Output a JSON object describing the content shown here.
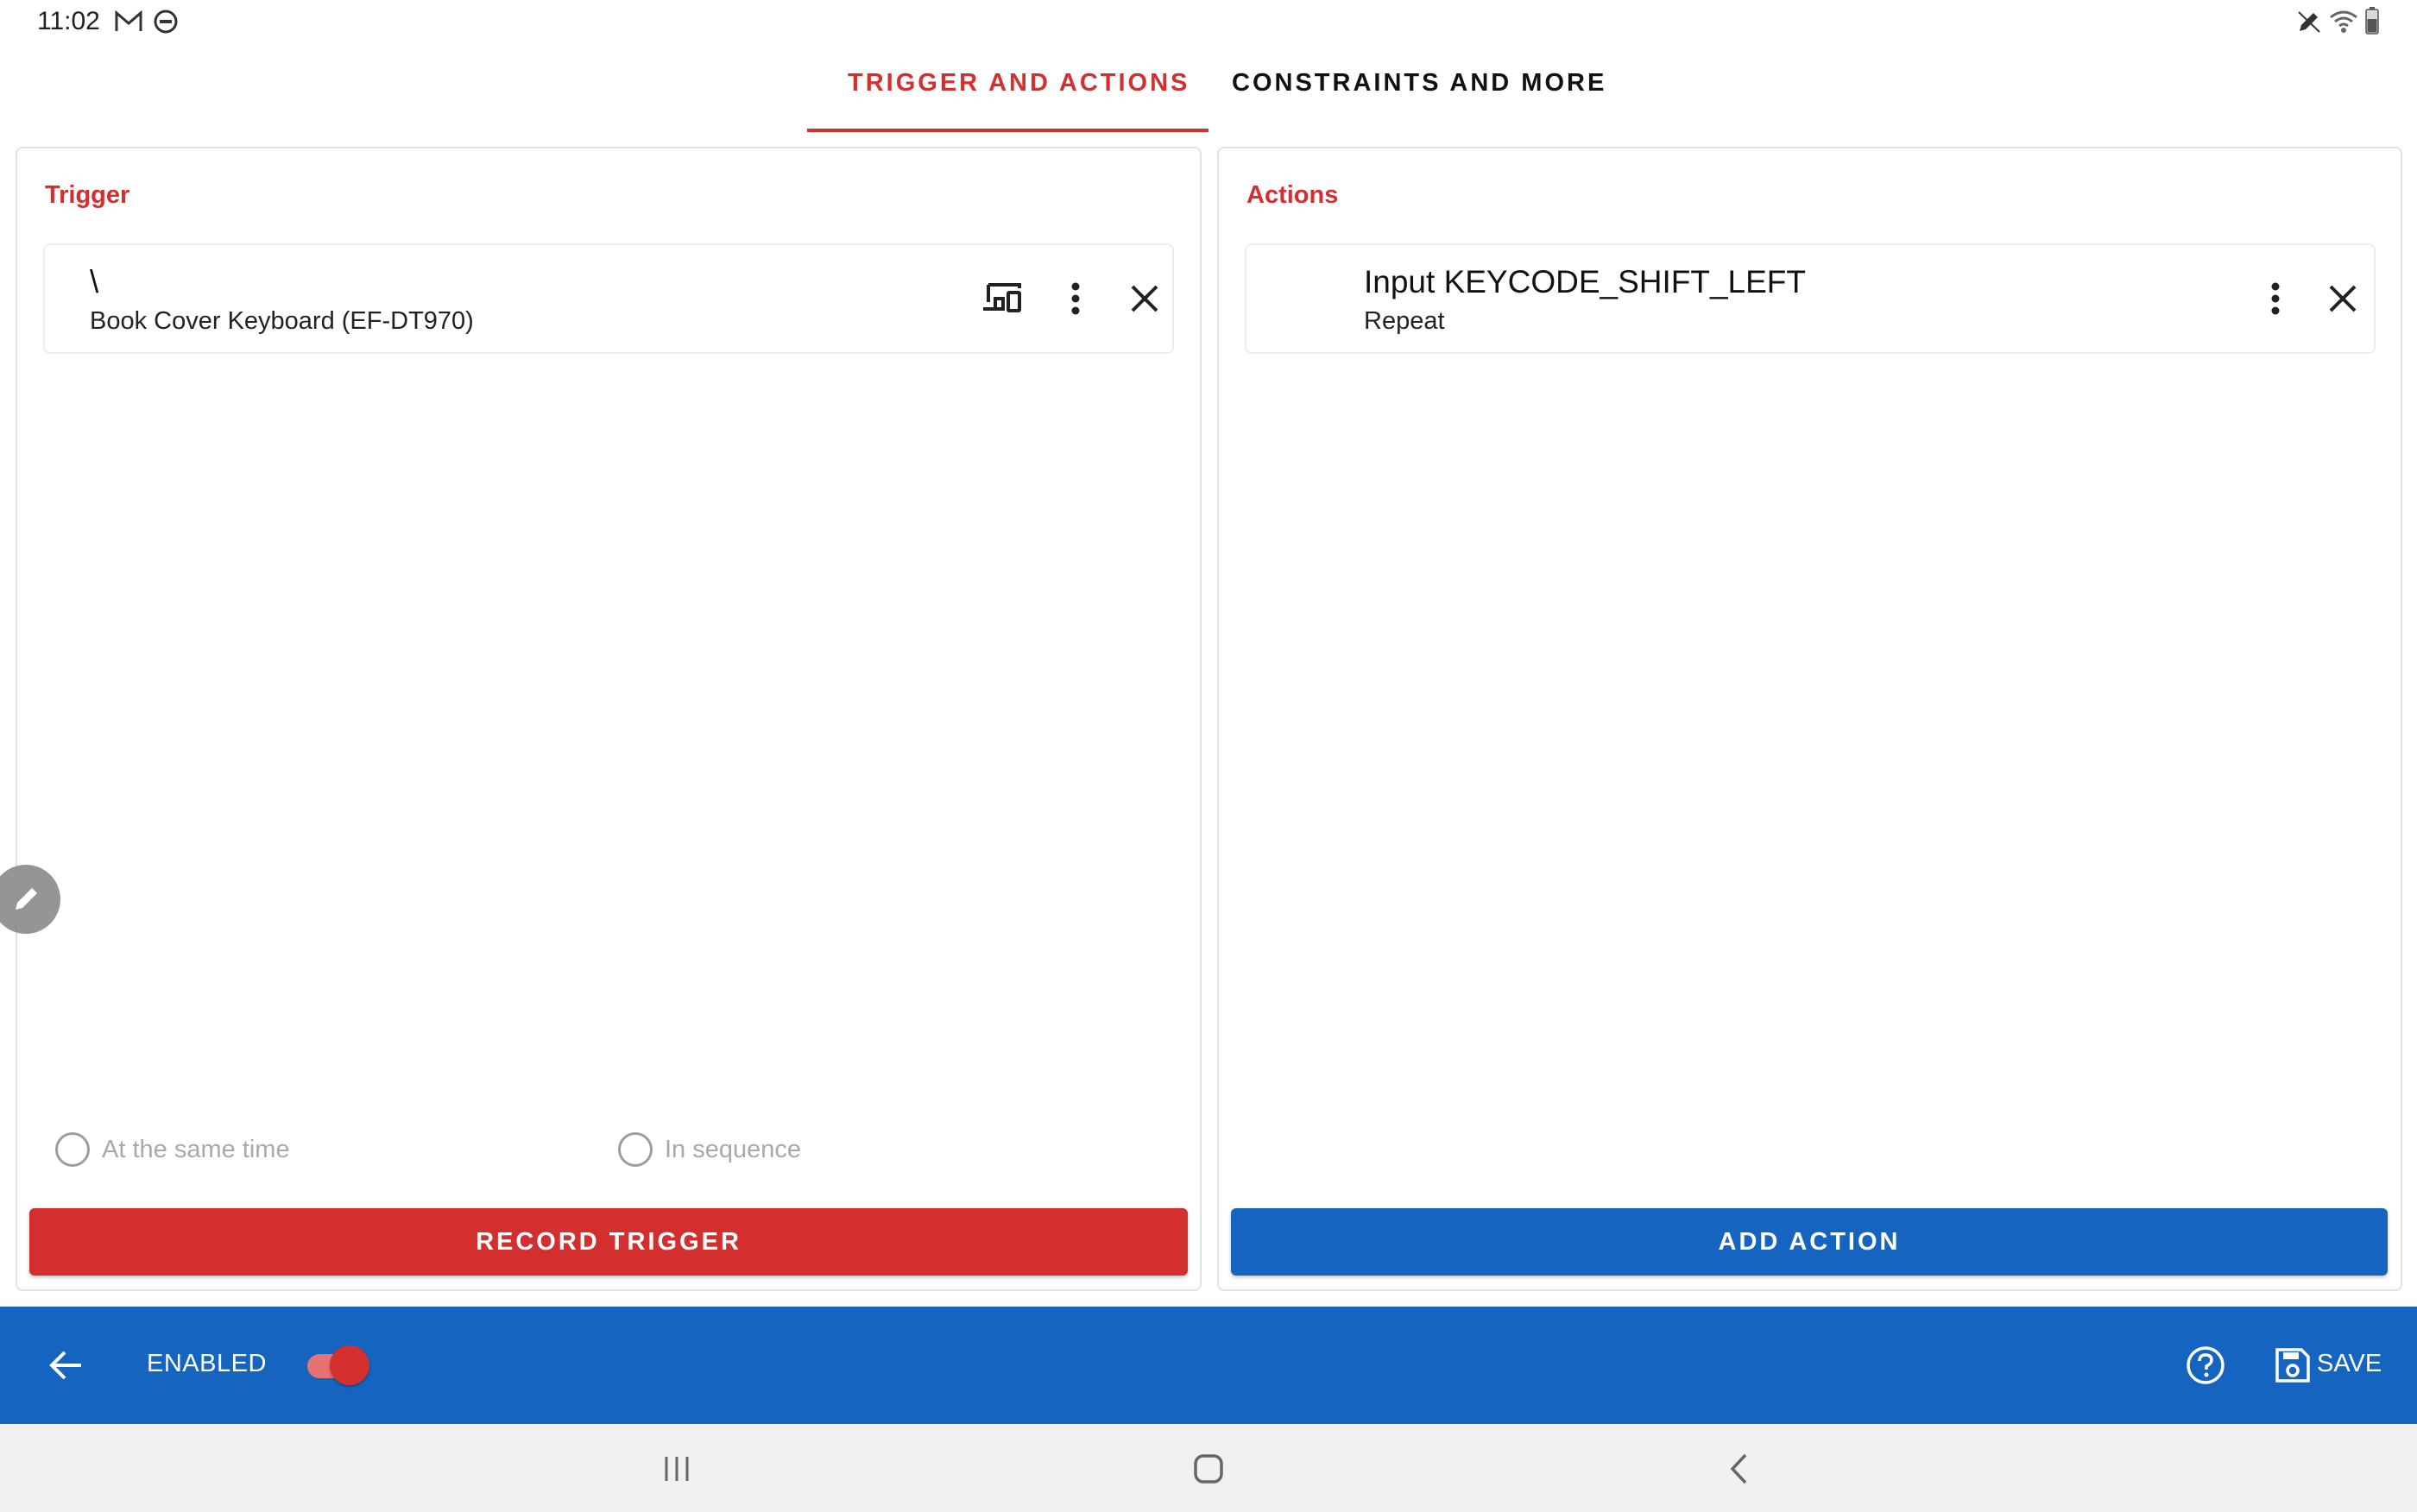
{
  "status_bar": {
    "time": "11:02",
    "left_icons": [
      "gmail-icon",
      "do-not-disturb-icon"
    ],
    "right_icons": [
      "pen-icon",
      "wifi-icon",
      "battery-icon"
    ]
  },
  "tabs": [
    {
      "label": "TRIGGER AND ACTIONS",
      "selected": true
    },
    {
      "label": "CONSTRAINTS AND MORE",
      "selected": false
    }
  ],
  "trigger_panel": {
    "title": "Trigger",
    "item": {
      "title": "\\",
      "subtitle": "Book Cover Keyboard (EF-DT970)"
    },
    "icons": [
      "device-choice-icon",
      "more-vert-icon",
      "close-icon"
    ],
    "radio_same_time": "At the same time",
    "radio_sequence": "In sequence",
    "button": "RECORD TRIGGER"
  },
  "actions_panel": {
    "title": "Actions",
    "item": {
      "title": "Input KEYCODE_SHIFT_LEFT",
      "subtitle": "Repeat"
    },
    "icons": [
      "more-vert-icon",
      "close-icon"
    ],
    "button": "ADD ACTION"
  },
  "bottom_bar": {
    "enabled_label": "ENABLED",
    "enabled": true,
    "save_label": "SAVE"
  },
  "colors": {
    "accent_red": "#d32f2f",
    "primary_blue": "#1565c0"
  }
}
